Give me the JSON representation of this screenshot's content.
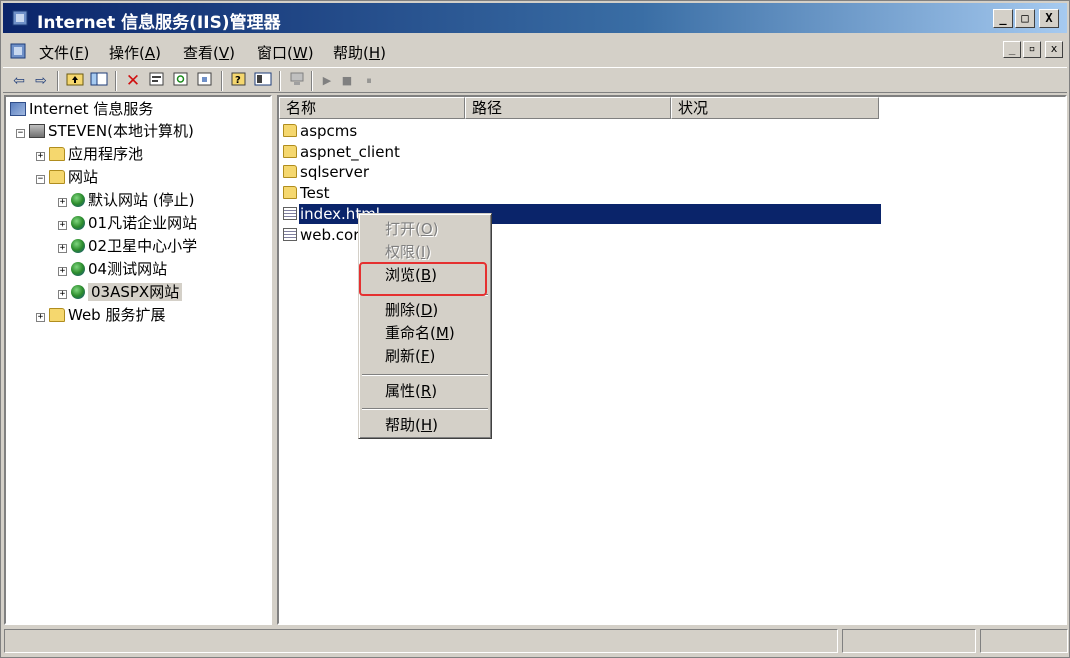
{
  "window": {
    "title": "Internet 信息服务(IIS)管理器",
    "controls": {
      "minimize": "_",
      "maximize": "□",
      "close": "X"
    }
  },
  "menubar": {
    "items": [
      {
        "label": "文件(",
        "key": "F",
        "tail": ")"
      },
      {
        "label": "操作(",
        "key": "A",
        "tail": ")"
      },
      {
        "label": "查看(",
        "key": "V",
        "tail": ")"
      },
      {
        "label": "窗口(",
        "key": "W",
        "tail": ")"
      },
      {
        "label": "帮助(",
        "key": "H",
        "tail": ")"
      }
    ],
    "mdi_controls": {
      "minimize": "_",
      "restore": "▫",
      "close": "x"
    }
  },
  "toolbar": {
    "buttons": [
      "back-icon",
      "forward-icon",
      "up-folder-icon",
      "show-tree-icon",
      "delete-icon",
      "properties-icon",
      "refresh-icon",
      "export-icon",
      "help-icon",
      "console-icon",
      "computer-icon",
      "start-icon",
      "stop-icon",
      "pause-icon"
    ]
  },
  "tree": {
    "root": "Internet 信息服务",
    "computer": "STEVEN(本地计算机)",
    "app_pools": "应用程序池",
    "websites": "网站",
    "sites": [
      "默认网站 (停止)",
      "01凡诺企业网站",
      "02卫星中心小学",
      "04测试网站",
      "03ASPX网站"
    ],
    "web_ext": "Web 服务扩展"
  },
  "list": {
    "columns": [
      "名称",
      "路径",
      "状况"
    ],
    "rows": [
      {
        "name": "aspcms",
        "type": "folder"
      },
      {
        "name": "aspnet_client",
        "type": "folder"
      },
      {
        "name": "sqlserver",
        "type": "folder"
      },
      {
        "name": "Test",
        "type": "folder"
      },
      {
        "name": "index.html",
        "type": "file"
      },
      {
        "name": "web.cor",
        "type": "file"
      }
    ]
  },
  "context_menu": {
    "items": [
      {
        "label": "打开(",
        "key": "O",
        "tail": ")",
        "disabled": true
      },
      {
        "label": "权限(",
        "key": "I",
        "tail": ")",
        "disabled": true
      },
      {
        "label": "浏览(",
        "key": "B",
        "tail": ")",
        "disabled": false
      },
      {
        "label": "删除(",
        "key": "D",
        "tail": ")",
        "disabled": false
      },
      {
        "label": "重命名(",
        "key": "M",
        "tail": ")",
        "disabled": false
      },
      {
        "label": "刷新(",
        "key": "F",
        "tail": ")",
        "disabled": false
      },
      {
        "label": "属性(",
        "key": "R",
        "tail": ")",
        "disabled": false
      },
      {
        "label": "帮助(",
        "key": "H",
        "tail": ")",
        "disabled": false
      }
    ]
  },
  "colors": {
    "highlight": "#e53030",
    "selection": "#0a246a",
    "titlebar_start": "#0a246a"
  }
}
